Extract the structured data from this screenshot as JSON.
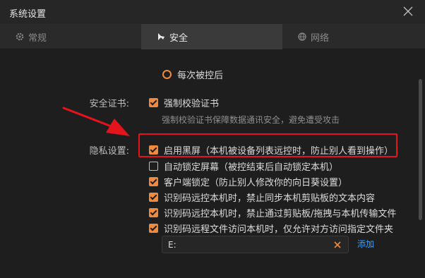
{
  "window": {
    "title": "系统设置"
  },
  "tabs": [
    {
      "label": "常规",
      "icon": "gear-icon",
      "active": false
    },
    {
      "label": "安全",
      "icon": "shield-lock-icon",
      "active": true
    },
    {
      "label": "网络",
      "icon": "globe-icon",
      "active": false
    }
  ],
  "security": {
    "radio_option": {
      "label": "每次被控后",
      "selected": false
    },
    "certificate": {
      "section_label": "安全证书:",
      "checkbox_label": "强制校验证书",
      "checked": true,
      "hint": "强制校验证书保障数据通讯安全，避免遭受攻击"
    },
    "privacy": {
      "section_label": "隐私设置:",
      "options": [
        {
          "label": "启用黑屏（本机被设备列表远控时，防止别人看到操作）",
          "checked": true
        },
        {
          "label": "自动锁定屏幕（被控结束后自动锁定本机）",
          "checked": false
        },
        {
          "label": "客户端锁定（防止别人修改你的向日葵设置）",
          "checked": true
        },
        {
          "label": "识别码远控本机时，禁止同步本机剪贴板的文本内容",
          "checked": true
        },
        {
          "label": "识别码远控本机时，禁止通过剪贴板/拖拽与本机传输文件",
          "checked": true
        },
        {
          "label": "识别码远程文件访问本机时，仅允许对方访问指定文件夹",
          "checked": true
        }
      ],
      "folder_input_value": "E:",
      "add_label": "添加"
    }
  },
  "colors": {
    "accent": "#f08a3c",
    "annotation_red": "#e3141b",
    "link": "#3aa0ff",
    "background": "#1e1e1e"
  }
}
